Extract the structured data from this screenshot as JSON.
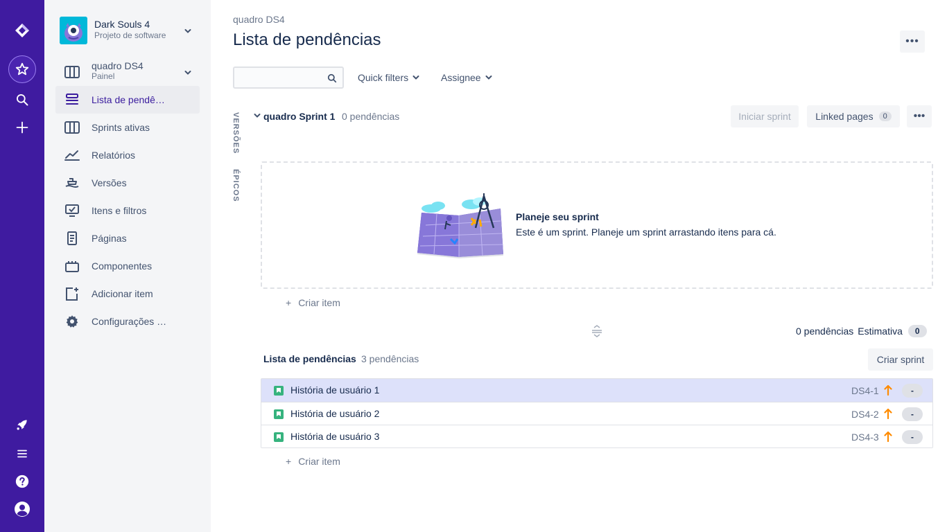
{
  "global_nav": {
    "icons": [
      "jira-logo-icon",
      "star-icon",
      "search-icon",
      "plus-icon",
      "rocket-icon",
      "menu-icon",
      "help-icon",
      "user-icon"
    ]
  },
  "project": {
    "name": "Dark Souls 4",
    "type": "Projeto de software"
  },
  "board": {
    "name": "quadro DS4",
    "type": "Painel"
  },
  "sidebar": {
    "items": [
      {
        "label": "Lista de pendê…",
        "icon": "backlog-icon",
        "active": true
      },
      {
        "label": "Sprints ativas",
        "icon": "board-icon"
      },
      {
        "label": "Relatórios",
        "icon": "chart-icon"
      },
      {
        "label": "Versões",
        "icon": "ship-icon"
      },
      {
        "label": "Itens e filtros",
        "icon": "issues-icon"
      },
      {
        "label": "Páginas",
        "icon": "page-icon"
      },
      {
        "label": "Componentes",
        "icon": "component-icon"
      },
      {
        "label": "Adicionar item",
        "icon": "add-item-icon"
      },
      {
        "label": "Configurações …",
        "icon": "gear-icon"
      }
    ]
  },
  "header": {
    "breadcrumb": "quadro DS4",
    "title": "Lista de pendências",
    "more_label": "•••"
  },
  "filters": {
    "search_placeholder": "",
    "quick_filters": "Quick filters",
    "assignee": "Assignee"
  },
  "side_tabs": {
    "versions": "VERSÕES",
    "epics": "ÉPICOS"
  },
  "sprint": {
    "name": "quadro Sprint 1",
    "count": "0 pendências",
    "start_button": "Iniciar sprint",
    "linked_pages_label": "Linked pages",
    "linked_pages_count": "0",
    "more_label": "•••",
    "empty_title": "Planeje seu sprint",
    "empty_text": "Este é um sprint. Planeje um sprint arrastando itens para cá.",
    "create_item": "Criar item",
    "summary_count": "0 pendências",
    "summary_estimate_label": "Estimativa",
    "summary_estimate_value": "0"
  },
  "backlog": {
    "title": "Lista de pendências",
    "count": "3 pendências",
    "create_sprint": "Criar sprint",
    "create_item": "Criar item",
    "issues": [
      {
        "title": "História de usuário 1",
        "key": "DS4-1",
        "estimate": "-",
        "priority_color": "#ff8b00",
        "selected": true
      },
      {
        "title": "História de usuário 2",
        "key": "DS4-2",
        "estimate": "-",
        "priority_color": "#ff8b00"
      },
      {
        "title": "História de usuário 3",
        "key": "DS4-3",
        "estimate": "-",
        "priority_color": "#ff8b00"
      }
    ]
  },
  "colors": {
    "global_nav_bg": "#3f1ba0",
    "story_green": "#36b37e",
    "selected_row": "#dde1fa"
  }
}
